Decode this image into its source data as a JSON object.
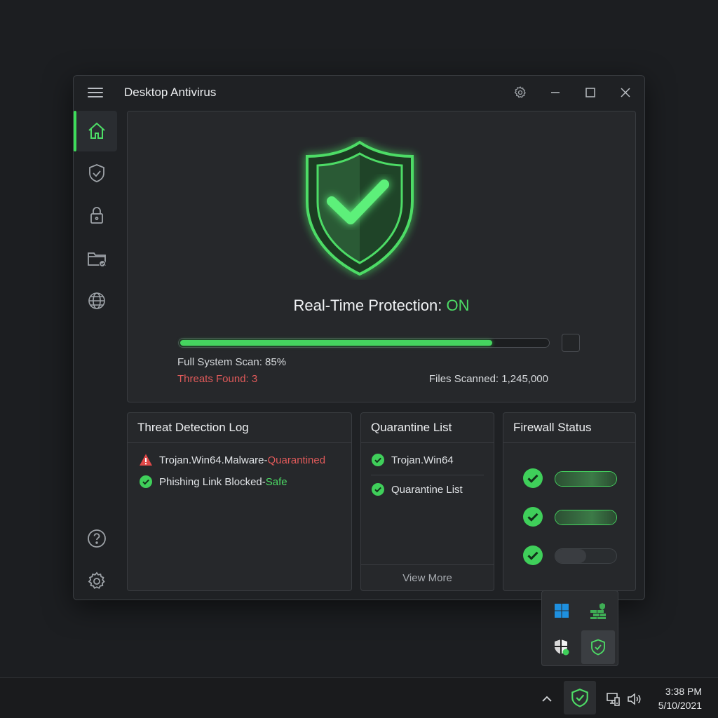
{
  "window": {
    "title": "Desktop Antivirus"
  },
  "sidebar": {
    "items": [
      {
        "name": "home",
        "active": true
      },
      {
        "name": "protection"
      },
      {
        "name": "privacy"
      },
      {
        "name": "quarantine-folder"
      },
      {
        "name": "web-protection"
      },
      {
        "name": "help"
      },
      {
        "name": "settings"
      }
    ]
  },
  "hero": {
    "protection_label": "Real-Time Protection:",
    "protection_state": "ON",
    "scan_label": "Full System Scan: 85%",
    "scan_progress": 0.85,
    "threats_label": "Threats Found: 3",
    "files_label": "Files Scanned: 1,245,000"
  },
  "threat_log": {
    "title": "Threat Detection Log",
    "entries": [
      {
        "name": "Trojan.Win64.Malware",
        "separator": " - ",
        "status": "Quarantined",
        "status_color": "#e05a5a",
        "icon": "warning-icon"
      },
      {
        "name": "Phishing Link Blocked",
        "separator": " - ",
        "status": "Safe",
        "status_color": "#4ddc66",
        "icon": "check-circle-icon"
      }
    ]
  },
  "quarantine": {
    "title": "Quarantine List",
    "items": [
      "Trojan.Win64",
      "Quarantine List"
    ],
    "view_more": "View More"
  },
  "firewall": {
    "title": "Firewall Status",
    "rules": [
      {
        "enabled": true,
        "level": 1.0
      },
      {
        "enabled": true,
        "level": 1.0
      },
      {
        "enabled": false,
        "level": 0.5
      }
    ]
  },
  "tray_flyout": {
    "icons": [
      "windows-icon",
      "firewall-icon",
      "security-center-icon",
      "antivirus-shield-icon"
    ]
  },
  "taskbar": {
    "time": "3:38 PM",
    "date": "5/10/2021"
  },
  "colors": {
    "accent": "#3ddc5a",
    "danger": "#e05a5a",
    "background": "#1c1e21"
  }
}
